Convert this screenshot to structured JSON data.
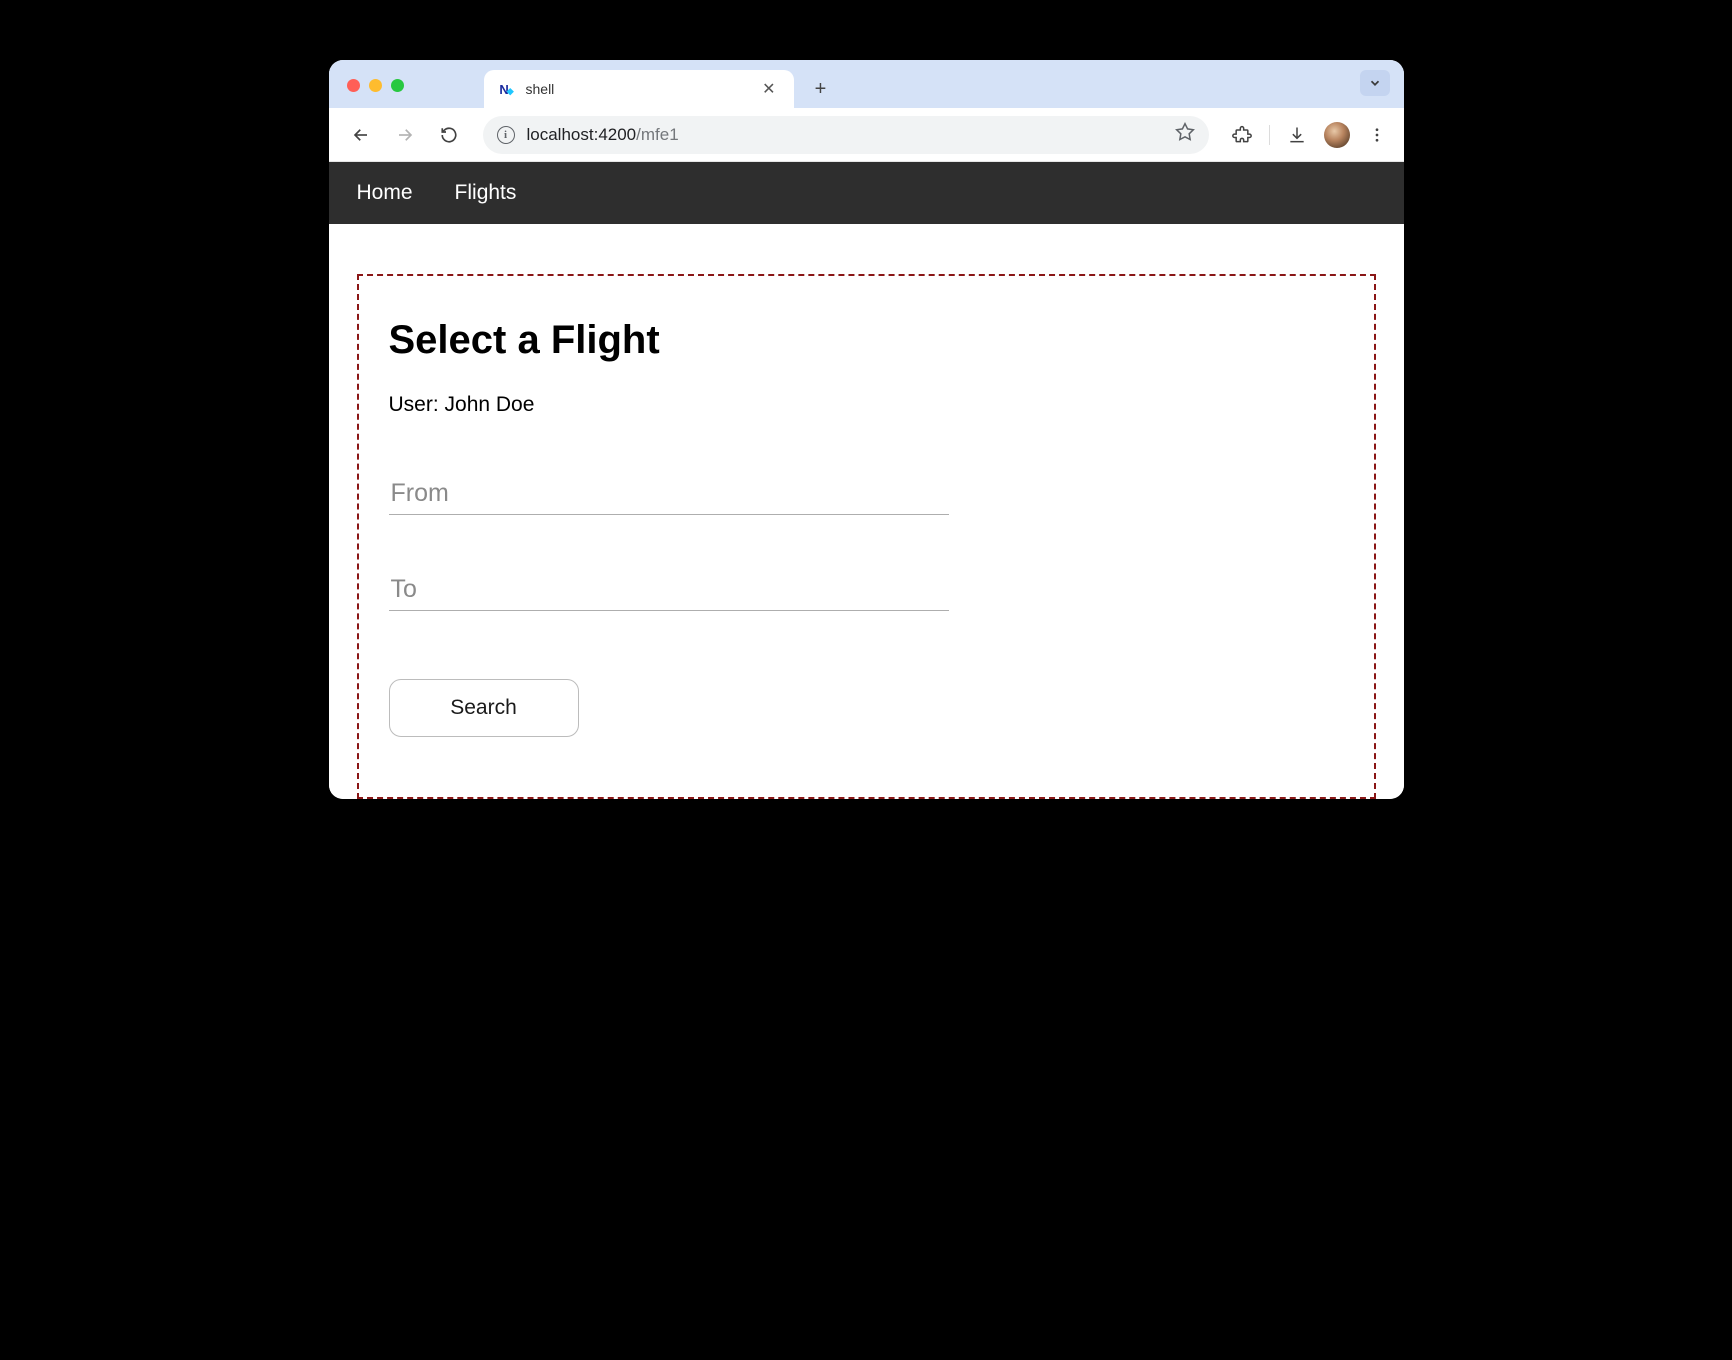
{
  "browser": {
    "tab": {
      "favicon_text": "N",
      "title": "shell"
    },
    "url": {
      "host": "localhost:4200",
      "path": "/mfe1"
    }
  },
  "app_nav": {
    "items": [
      {
        "label": "Home"
      },
      {
        "label": "Flights"
      }
    ]
  },
  "mfe": {
    "title": "Select a Flight",
    "user_label": "User: ",
    "user_name": "John Doe",
    "from_placeholder": "From",
    "from_value": "",
    "to_placeholder": "To",
    "to_value": "",
    "search_label": "Search"
  }
}
